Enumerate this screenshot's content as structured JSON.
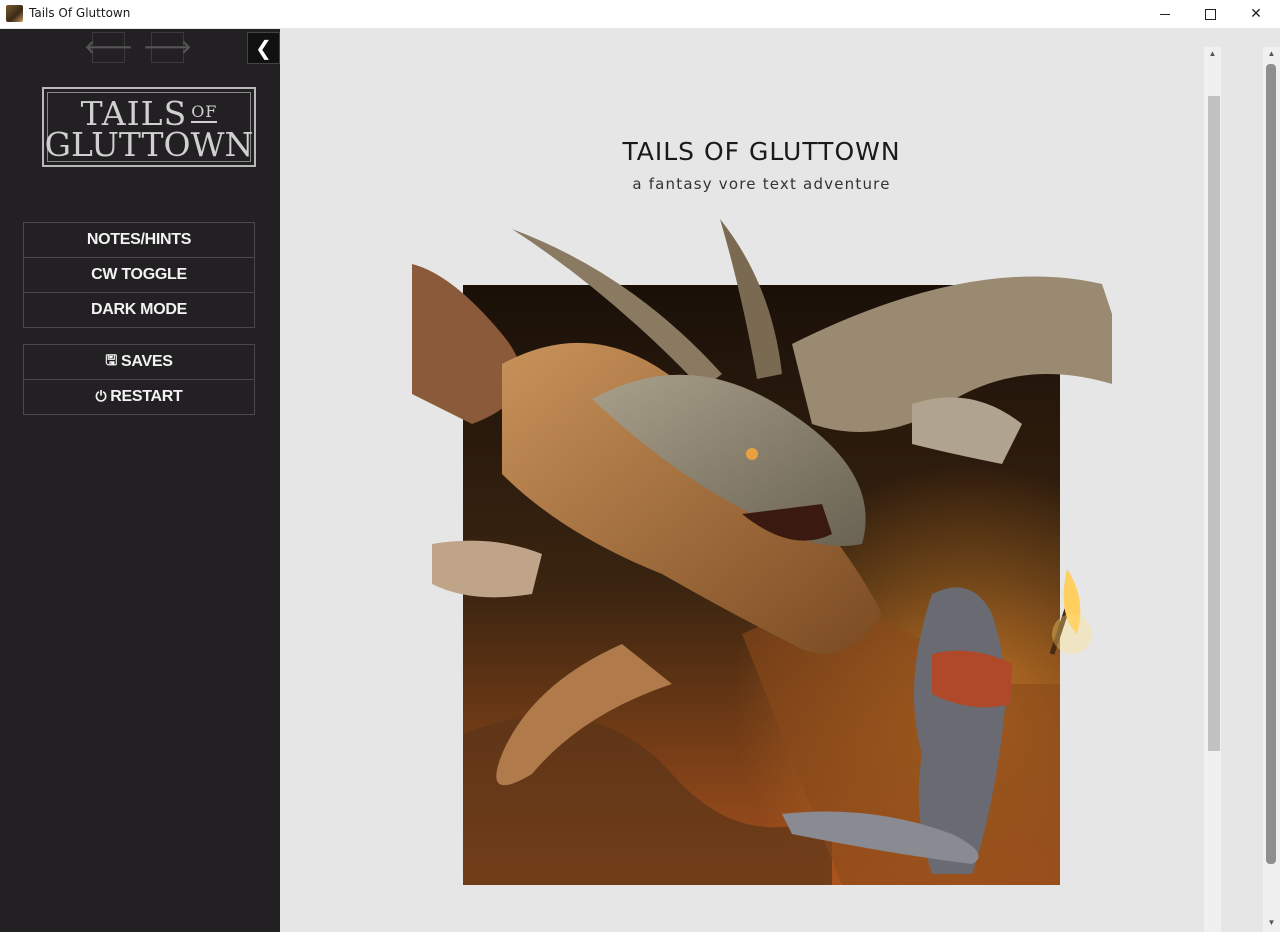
{
  "window": {
    "title": "Tails Of Gluttown",
    "icon": "app-icon",
    "controls": {
      "minimize": "minimize-icon",
      "maximize": "maximize-icon",
      "close": "✕"
    }
  },
  "sidebar": {
    "back_icon": "🡐",
    "forward_icon": "🡒",
    "collapse_icon": "❮",
    "logo": {
      "line1": "TAILS",
      "of": "OF",
      "line2": "GLUTTOWN"
    },
    "menu_primary": [
      {
        "label": "NOTES/HINTS"
      },
      {
        "label": "CW TOGGLE"
      },
      {
        "label": "DARK MODE"
      }
    ],
    "menu_secondary": [
      {
        "label": "SAVES",
        "icon": "🖫"
      },
      {
        "label": "RESTART",
        "icon": "⏻"
      }
    ]
  },
  "main": {
    "title": "TAILS OF GLUTTOWN",
    "subtitle": "a fantasy vore text adventure",
    "illustration": "dragon-and-kobold-cover-art"
  },
  "scrollbars": {
    "up_arrow": "▲",
    "down_arrow": "▼"
  },
  "colors": {
    "sidebar_bg": "#222022",
    "main_bg": "#e6e6e6",
    "menu_border": "#4a4a4a"
  }
}
